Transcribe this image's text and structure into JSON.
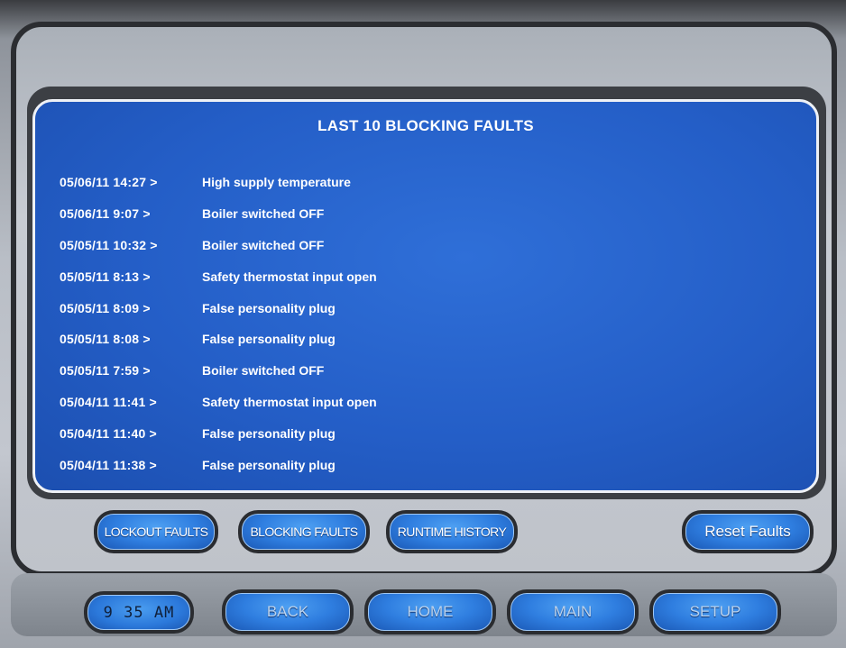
{
  "panel": {
    "title": "LAST 10 BLOCKING FAULTS",
    "faults": [
      {
        "time": "05/06/11 14:27 >",
        "description": "High supply temperature"
      },
      {
        "time": "05/06/11  9:07 >",
        "description": "Boiler switched OFF"
      },
      {
        "time": "05/05/11 10:32 >",
        "description": "Boiler switched OFF"
      },
      {
        "time": "05/05/11  8:13 >",
        "description": "Safety thermostat input open"
      },
      {
        "time": "05/05/11  8:09 >",
        "description": "False personality plug"
      },
      {
        "time": "05/05/11  8:08 >",
        "description": "False personality plug"
      },
      {
        "time": "05/05/11  7:59 >",
        "description": "Boiler switched OFF"
      },
      {
        "time": "05/04/11 11:41 >",
        "description": "Safety thermostat input open"
      },
      {
        "time": "05/04/11 11:40 >",
        "description": "False personality plug"
      },
      {
        "time": "05/04/11 11:38 >",
        "description": "False personality plug"
      }
    ]
  },
  "fault_buttons": {
    "lockout": "LOCKOUT FAULTS",
    "blocking": "BLOCKING FAULTS",
    "runtime": "RUNTIME HISTORY",
    "reset": "Reset Faults"
  },
  "nav": {
    "clock": "9 35 AM",
    "back": "BACK",
    "home": "HOME",
    "main": "MAIN",
    "setup": "SETUP"
  },
  "colors": {
    "panel_blue": "#245ec7",
    "button_blue": "#2f7ee0",
    "text_white": "#ffffff"
  }
}
